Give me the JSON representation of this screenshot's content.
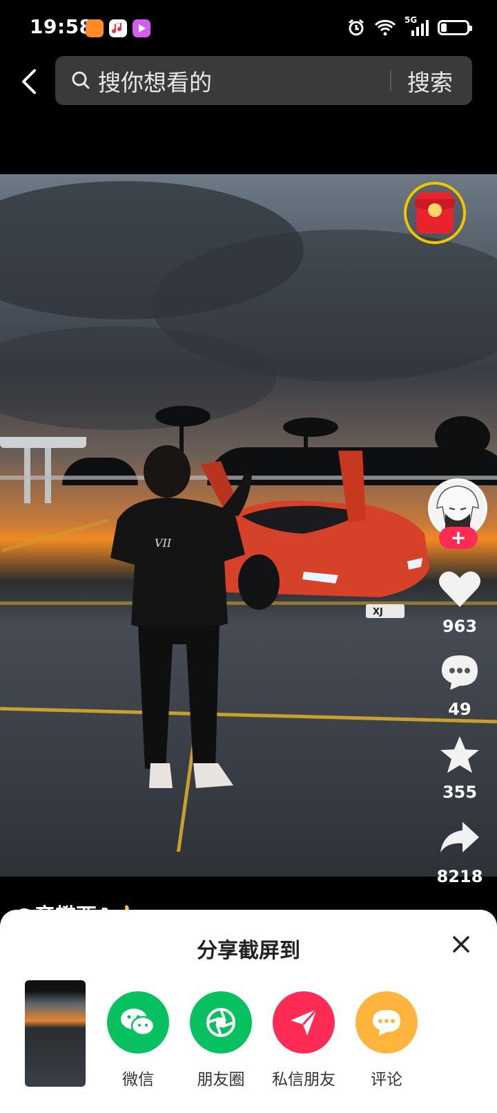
{
  "status_bar": {
    "time": "19:58",
    "network": "5G",
    "icons": [
      "heart-app-icon",
      "music-app-icon",
      "video-app-icon",
      "alarm-icon",
      "wifi-icon",
      "signal-icon",
      "battery-icon"
    ]
  },
  "header": {
    "search_placeholder": "搜你想看的",
    "search_button": "搜索"
  },
  "video": {
    "plate": "XJ",
    "shirt_text": "VII",
    "author_peek": "@帝樊西A👍"
  },
  "rail": {
    "likes": "963",
    "comments": "49",
    "favorites": "355",
    "shares": "8218"
  },
  "share_sheet": {
    "title": "分享截屏到",
    "options": [
      {
        "label": "微信",
        "color": "#07c160",
        "icon": "wechat-icon"
      },
      {
        "label": "朋友圈",
        "color": "#07c160",
        "icon": "moments-icon"
      },
      {
        "label": "私信朋友",
        "color": "#fe2c55",
        "icon": "send-icon"
      },
      {
        "label": "评论",
        "color": "#ffb43e",
        "icon": "comment-icon"
      }
    ]
  },
  "colors": {
    "accent_red": "#fe2c55",
    "wechat_green": "#07c160",
    "comment_yellow": "#ffb43e"
  }
}
